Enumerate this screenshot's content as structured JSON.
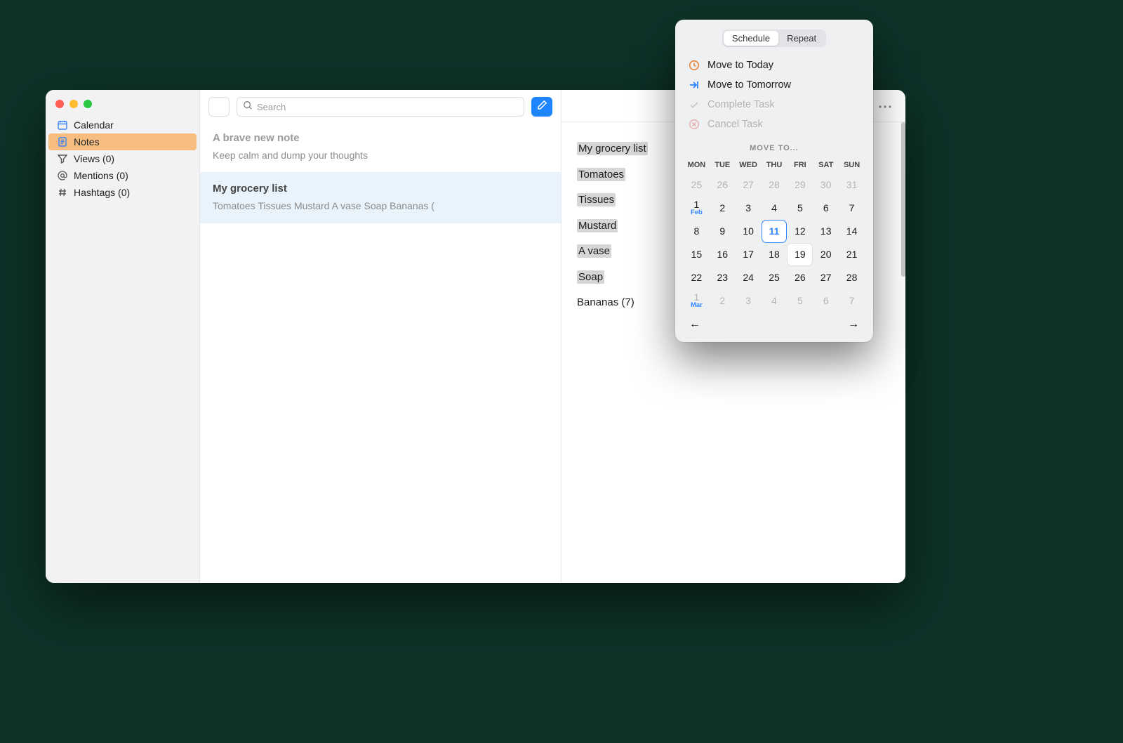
{
  "sidebar": {
    "items": [
      {
        "label": "Calendar",
        "icon": "calendar-icon",
        "selected": false,
        "iconColor": "blue"
      },
      {
        "label": "Notes",
        "icon": "note-icon",
        "selected": true,
        "iconColor": "blue"
      },
      {
        "label": "Views (0)",
        "icon": "funnel-icon",
        "selected": false,
        "iconColor": "gray"
      },
      {
        "label": "Mentions (0)",
        "icon": "at-icon",
        "selected": false,
        "iconColor": "gray"
      },
      {
        "label": "Hashtags (0)",
        "icon": "hash-icon",
        "selected": false,
        "iconColor": "gray"
      }
    ]
  },
  "search": {
    "placeholder": "Search"
  },
  "notes": [
    {
      "title": "A brave new note",
      "preview": "Keep calm and dump your thoughts",
      "placeholder": true,
      "selected": false
    },
    {
      "title": "My grocery list",
      "preview": "Tomatoes Tissues Mustard A vase Soap Bananas (",
      "placeholder": false,
      "selected": true
    }
  ],
  "detail": {
    "lines": [
      "My grocery list",
      "Tomatoes",
      "Tissues",
      "Mustard",
      "A vase",
      "Soap",
      "Bananas (7)"
    ],
    "highlightedThrough": 5
  },
  "popover": {
    "tabs": {
      "schedule": "Schedule",
      "repeat": "Repeat",
      "active": "schedule"
    },
    "menu": {
      "today": "Move to Today",
      "tomorrow": "Move to Tomorrow",
      "complete": "Complete Task",
      "cancel": "Cancel Task"
    },
    "calendar": {
      "title": "MOVE TO...",
      "weekdays": [
        "MON",
        "TUE",
        "WED",
        "THU",
        "FRI",
        "SAT",
        "SUN"
      ],
      "rows": [
        [
          {
            "n": "25",
            "muted": true
          },
          {
            "n": "26",
            "muted": true
          },
          {
            "n": "27",
            "muted": true
          },
          {
            "n": "28",
            "muted": true
          },
          {
            "n": "29",
            "muted": true
          },
          {
            "n": "30",
            "muted": true
          },
          {
            "n": "31",
            "muted": true
          }
        ],
        [
          {
            "n": "1",
            "month": "Feb"
          },
          {
            "n": "2"
          },
          {
            "n": "3"
          },
          {
            "n": "4"
          },
          {
            "n": "5"
          },
          {
            "n": "6"
          },
          {
            "n": "7"
          }
        ],
        [
          {
            "n": "8"
          },
          {
            "n": "9"
          },
          {
            "n": "10"
          },
          {
            "n": "11",
            "today": true
          },
          {
            "n": "12"
          },
          {
            "n": "13"
          },
          {
            "n": "14"
          }
        ],
        [
          {
            "n": "15"
          },
          {
            "n": "16"
          },
          {
            "n": "17"
          },
          {
            "n": "18"
          },
          {
            "n": "19",
            "hover": true
          },
          {
            "n": "20"
          },
          {
            "n": "21"
          }
        ],
        [
          {
            "n": "22"
          },
          {
            "n": "23"
          },
          {
            "n": "24"
          },
          {
            "n": "25"
          },
          {
            "n": "26"
          },
          {
            "n": "27"
          },
          {
            "n": "28"
          }
        ],
        [
          {
            "n": "1",
            "month": "Mar",
            "muted": true
          },
          {
            "n": "2",
            "muted": true
          },
          {
            "n": "3",
            "muted": true
          },
          {
            "n": "4",
            "muted": true
          },
          {
            "n": "5",
            "muted": true
          },
          {
            "n": "6",
            "muted": true
          },
          {
            "n": "7",
            "muted": true
          }
        ]
      ]
    }
  }
}
